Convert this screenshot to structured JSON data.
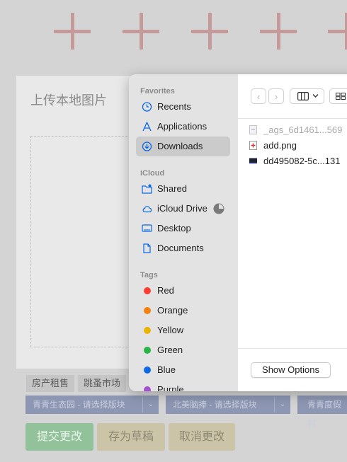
{
  "background_page": {
    "upload_title": "上传本地图片",
    "tags": [
      "房产租售",
      "跳蚤市场"
    ],
    "selects": [
      "青青生态园 - 请选择版块",
      "北美脑捧 - 请选择版块",
      "青青度假村"
    ],
    "buttons": {
      "submit": "提交更改",
      "draft": "存为草稿",
      "cancel": "取消更改"
    }
  },
  "dialog": {
    "sidebar": {
      "favorites_header": "Favorites",
      "favorites": [
        {
          "label": "Recents",
          "icon": "clock-icon"
        },
        {
          "label": "Applications",
          "icon": "applications-icon"
        },
        {
          "label": "Downloads",
          "icon": "download-icon",
          "selected": true
        }
      ],
      "icloud_header": "iCloud",
      "icloud": [
        {
          "label": "Shared",
          "icon": "shared-folder-icon"
        },
        {
          "label": "iCloud Drive",
          "icon": "cloud-icon"
        },
        {
          "label": "Desktop",
          "icon": "desktop-icon"
        },
        {
          "label": "Documents",
          "icon": "document-icon"
        }
      ],
      "tags_header": "Tags",
      "tags": [
        {
          "label": "Red",
          "color": "#ff3b30"
        },
        {
          "label": "Orange",
          "color": "#f5820d"
        },
        {
          "label": "Yellow",
          "color": "#e9b400"
        },
        {
          "label": "Green",
          "color": "#28b446"
        },
        {
          "label": "Blue",
          "color": "#0a69e6"
        },
        {
          "label": "Purple",
          "color": "#a550d2"
        }
      ]
    },
    "files": [
      {
        "name": "_ags_6d1461...569",
        "dimmed": true,
        "icon": "file-icon"
      },
      {
        "name": "add.png",
        "dimmed": false,
        "icon": "image-file-icon"
      },
      {
        "name": "dd495082-5c...131",
        "dimmed": false,
        "icon": "screenshot-file-icon"
      }
    ],
    "show_options": "Show Options"
  },
  "colors": {
    "accent": "#0a69e6",
    "submit_green": "#92c29a",
    "draft_tan": "#ccc4a6",
    "select_blue": "#8d97b3"
  }
}
